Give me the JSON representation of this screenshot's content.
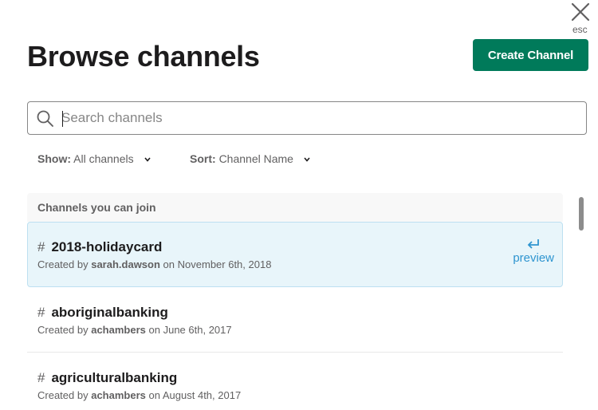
{
  "close": {
    "esc_label": "esc",
    "icon": "close-icon"
  },
  "header": {
    "title": "Browse channels",
    "create_label": "Create Channel"
  },
  "search": {
    "placeholder": "Search channels",
    "value": ""
  },
  "filters": {
    "show_label": "Show:",
    "show_value": "All channels",
    "sort_label": "Sort:",
    "sort_value": "Channel Name"
  },
  "list": {
    "section_title": "Channels you can join",
    "preview_label": "preview",
    "channels": [
      {
        "hash": "#",
        "name": "2018-holidaycard",
        "created_prefix": "Created by",
        "creator": "sarah.dawson",
        "date_prefix": "on",
        "date": "November 6th, 2018"
      },
      {
        "hash": "#",
        "name": "aboriginalbanking",
        "created_prefix": "Created by",
        "creator": "achambers",
        "date_prefix": "on",
        "date": "June 6th, 2017"
      },
      {
        "hash": "#",
        "name": "agriculturalbanking",
        "created_prefix": "Created by",
        "creator": "achambers",
        "date_prefix": "on",
        "date": "August 4th, 2017"
      }
    ]
  },
  "colors": {
    "primary_button": "#007a5a",
    "selected_row_bg": "#e8f5fa",
    "preview_link": "#2f95d0"
  }
}
